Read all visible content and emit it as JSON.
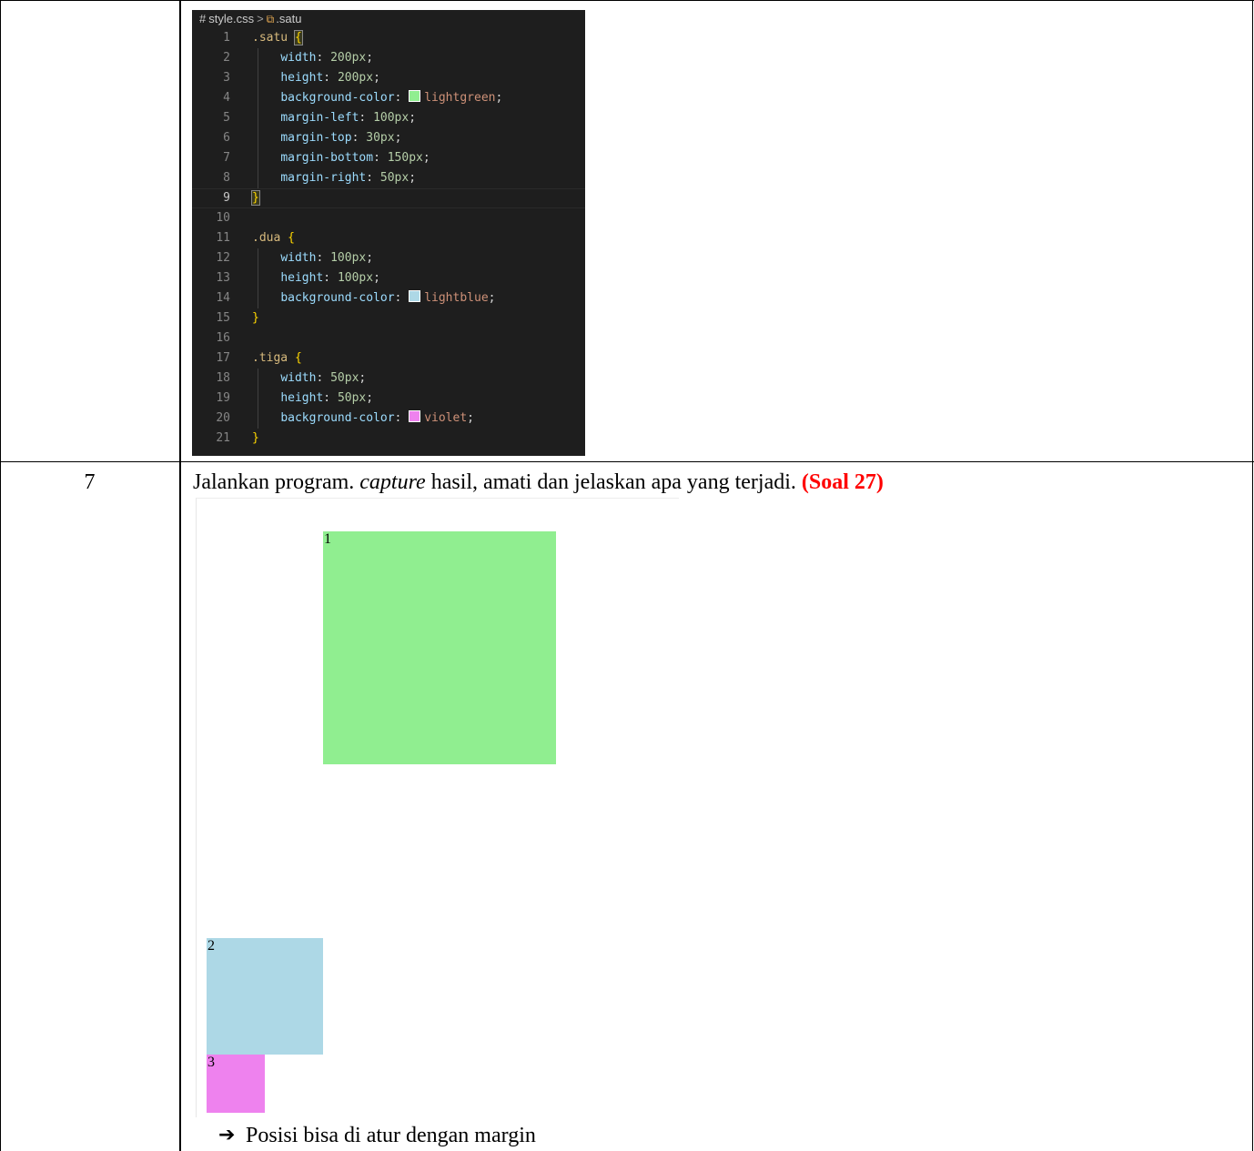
{
  "editor": {
    "breadcrumb_file": "style.css",
    "breadcrumb_symbol": ".satu",
    "lines": [
      {
        "n": "1",
        "parts": [
          [
            "selector",
            ".satu "
          ],
          [
            "brace-match",
            "{"
          ]
        ]
      },
      {
        "n": "2",
        "parts": [
          [
            "prop",
            "width"
          ],
          [
            "punct",
            ": "
          ],
          [
            "num",
            "200px"
          ],
          [
            "punct",
            ";"
          ]
        ]
      },
      {
        "n": "3",
        "parts": [
          [
            "prop",
            "height"
          ],
          [
            "punct",
            ": "
          ],
          [
            "num",
            "200px"
          ],
          [
            "punct",
            ";"
          ]
        ]
      },
      {
        "n": "4",
        "parts": [
          [
            "prop",
            "background-color"
          ],
          [
            "punct",
            ": "
          ],
          [
            "swatch",
            "#90ee90"
          ],
          [
            "val",
            "lightgreen"
          ],
          [
            "punct",
            ";"
          ]
        ]
      },
      {
        "n": "5",
        "parts": [
          [
            "prop",
            "margin-left"
          ],
          [
            "punct",
            ": "
          ],
          [
            "num",
            "100px"
          ],
          [
            "punct",
            ";"
          ]
        ]
      },
      {
        "n": "6",
        "parts": [
          [
            "prop",
            "margin-top"
          ],
          [
            "punct",
            ": "
          ],
          [
            "num",
            "30px"
          ],
          [
            "punct",
            ";"
          ]
        ]
      },
      {
        "n": "7",
        "parts": [
          [
            "prop",
            "margin-bottom"
          ],
          [
            "punct",
            ": "
          ],
          [
            "num",
            "150px"
          ],
          [
            "punct",
            ";"
          ]
        ]
      },
      {
        "n": "8",
        "parts": [
          [
            "prop",
            "margin-right"
          ],
          [
            "punct",
            ": "
          ],
          [
            "num",
            "50px"
          ],
          [
            "punct",
            ";"
          ]
        ]
      },
      {
        "n": "9",
        "parts": [
          [
            "brace-match",
            "}"
          ]
        ],
        "current": true
      },
      {
        "n": "10",
        "parts": []
      },
      {
        "n": "11",
        "parts": [
          [
            "selector",
            ".dua "
          ],
          [
            "brace",
            "{"
          ]
        ]
      },
      {
        "n": "12",
        "parts": [
          [
            "prop",
            "width"
          ],
          [
            "punct",
            ": "
          ],
          [
            "num",
            "100px"
          ],
          [
            "punct",
            ";"
          ]
        ]
      },
      {
        "n": "13",
        "parts": [
          [
            "prop",
            "height"
          ],
          [
            "punct",
            ": "
          ],
          [
            "num",
            "100px"
          ],
          [
            "punct",
            ";"
          ]
        ]
      },
      {
        "n": "14",
        "parts": [
          [
            "prop",
            "background-color"
          ],
          [
            "punct",
            ": "
          ],
          [
            "swatch",
            "#add8e6"
          ],
          [
            "val",
            "lightblue"
          ],
          [
            "punct",
            ";"
          ]
        ]
      },
      {
        "n": "15",
        "parts": [
          [
            "brace",
            "}"
          ]
        ]
      },
      {
        "n": "16",
        "parts": []
      },
      {
        "n": "17",
        "parts": [
          [
            "selector",
            ".tiga "
          ],
          [
            "brace",
            "{"
          ]
        ]
      },
      {
        "n": "18",
        "parts": [
          [
            "prop",
            "width"
          ],
          [
            "punct",
            ": "
          ],
          [
            "num",
            "50px"
          ],
          [
            "punct",
            ";"
          ]
        ]
      },
      {
        "n": "19",
        "parts": [
          [
            "prop",
            "height"
          ],
          [
            "punct",
            ": "
          ],
          [
            "num",
            "50px"
          ],
          [
            "punct",
            ";"
          ]
        ]
      },
      {
        "n": "20",
        "parts": [
          [
            "prop",
            "background-color"
          ],
          [
            "punct",
            ": "
          ],
          [
            "swatch",
            "#ee82ee"
          ],
          [
            "val",
            "violet"
          ],
          [
            "punct",
            ";"
          ]
        ]
      },
      {
        "n": "21",
        "parts": [
          [
            "brace",
            "}"
          ]
        ]
      }
    ]
  },
  "row7": {
    "number": "7",
    "instruction_before": "Jalankan program. ",
    "instruction_em": "capture",
    "instruction_after": " hasil, amati dan jelaskan apa yang terjadi. ",
    "instruction_soal": "(Soal 27)"
  },
  "capture": {
    "box1_label": "1",
    "box2_label": "2",
    "box3_label": "3",
    "colors": {
      "box1": "#90ee90",
      "box2": "#add8e6",
      "box3": "#ee82ee"
    }
  },
  "note": {
    "arrow_icon": "right-arrow-icon",
    "text": "Posisi bisa di atur dengan margin"
  }
}
